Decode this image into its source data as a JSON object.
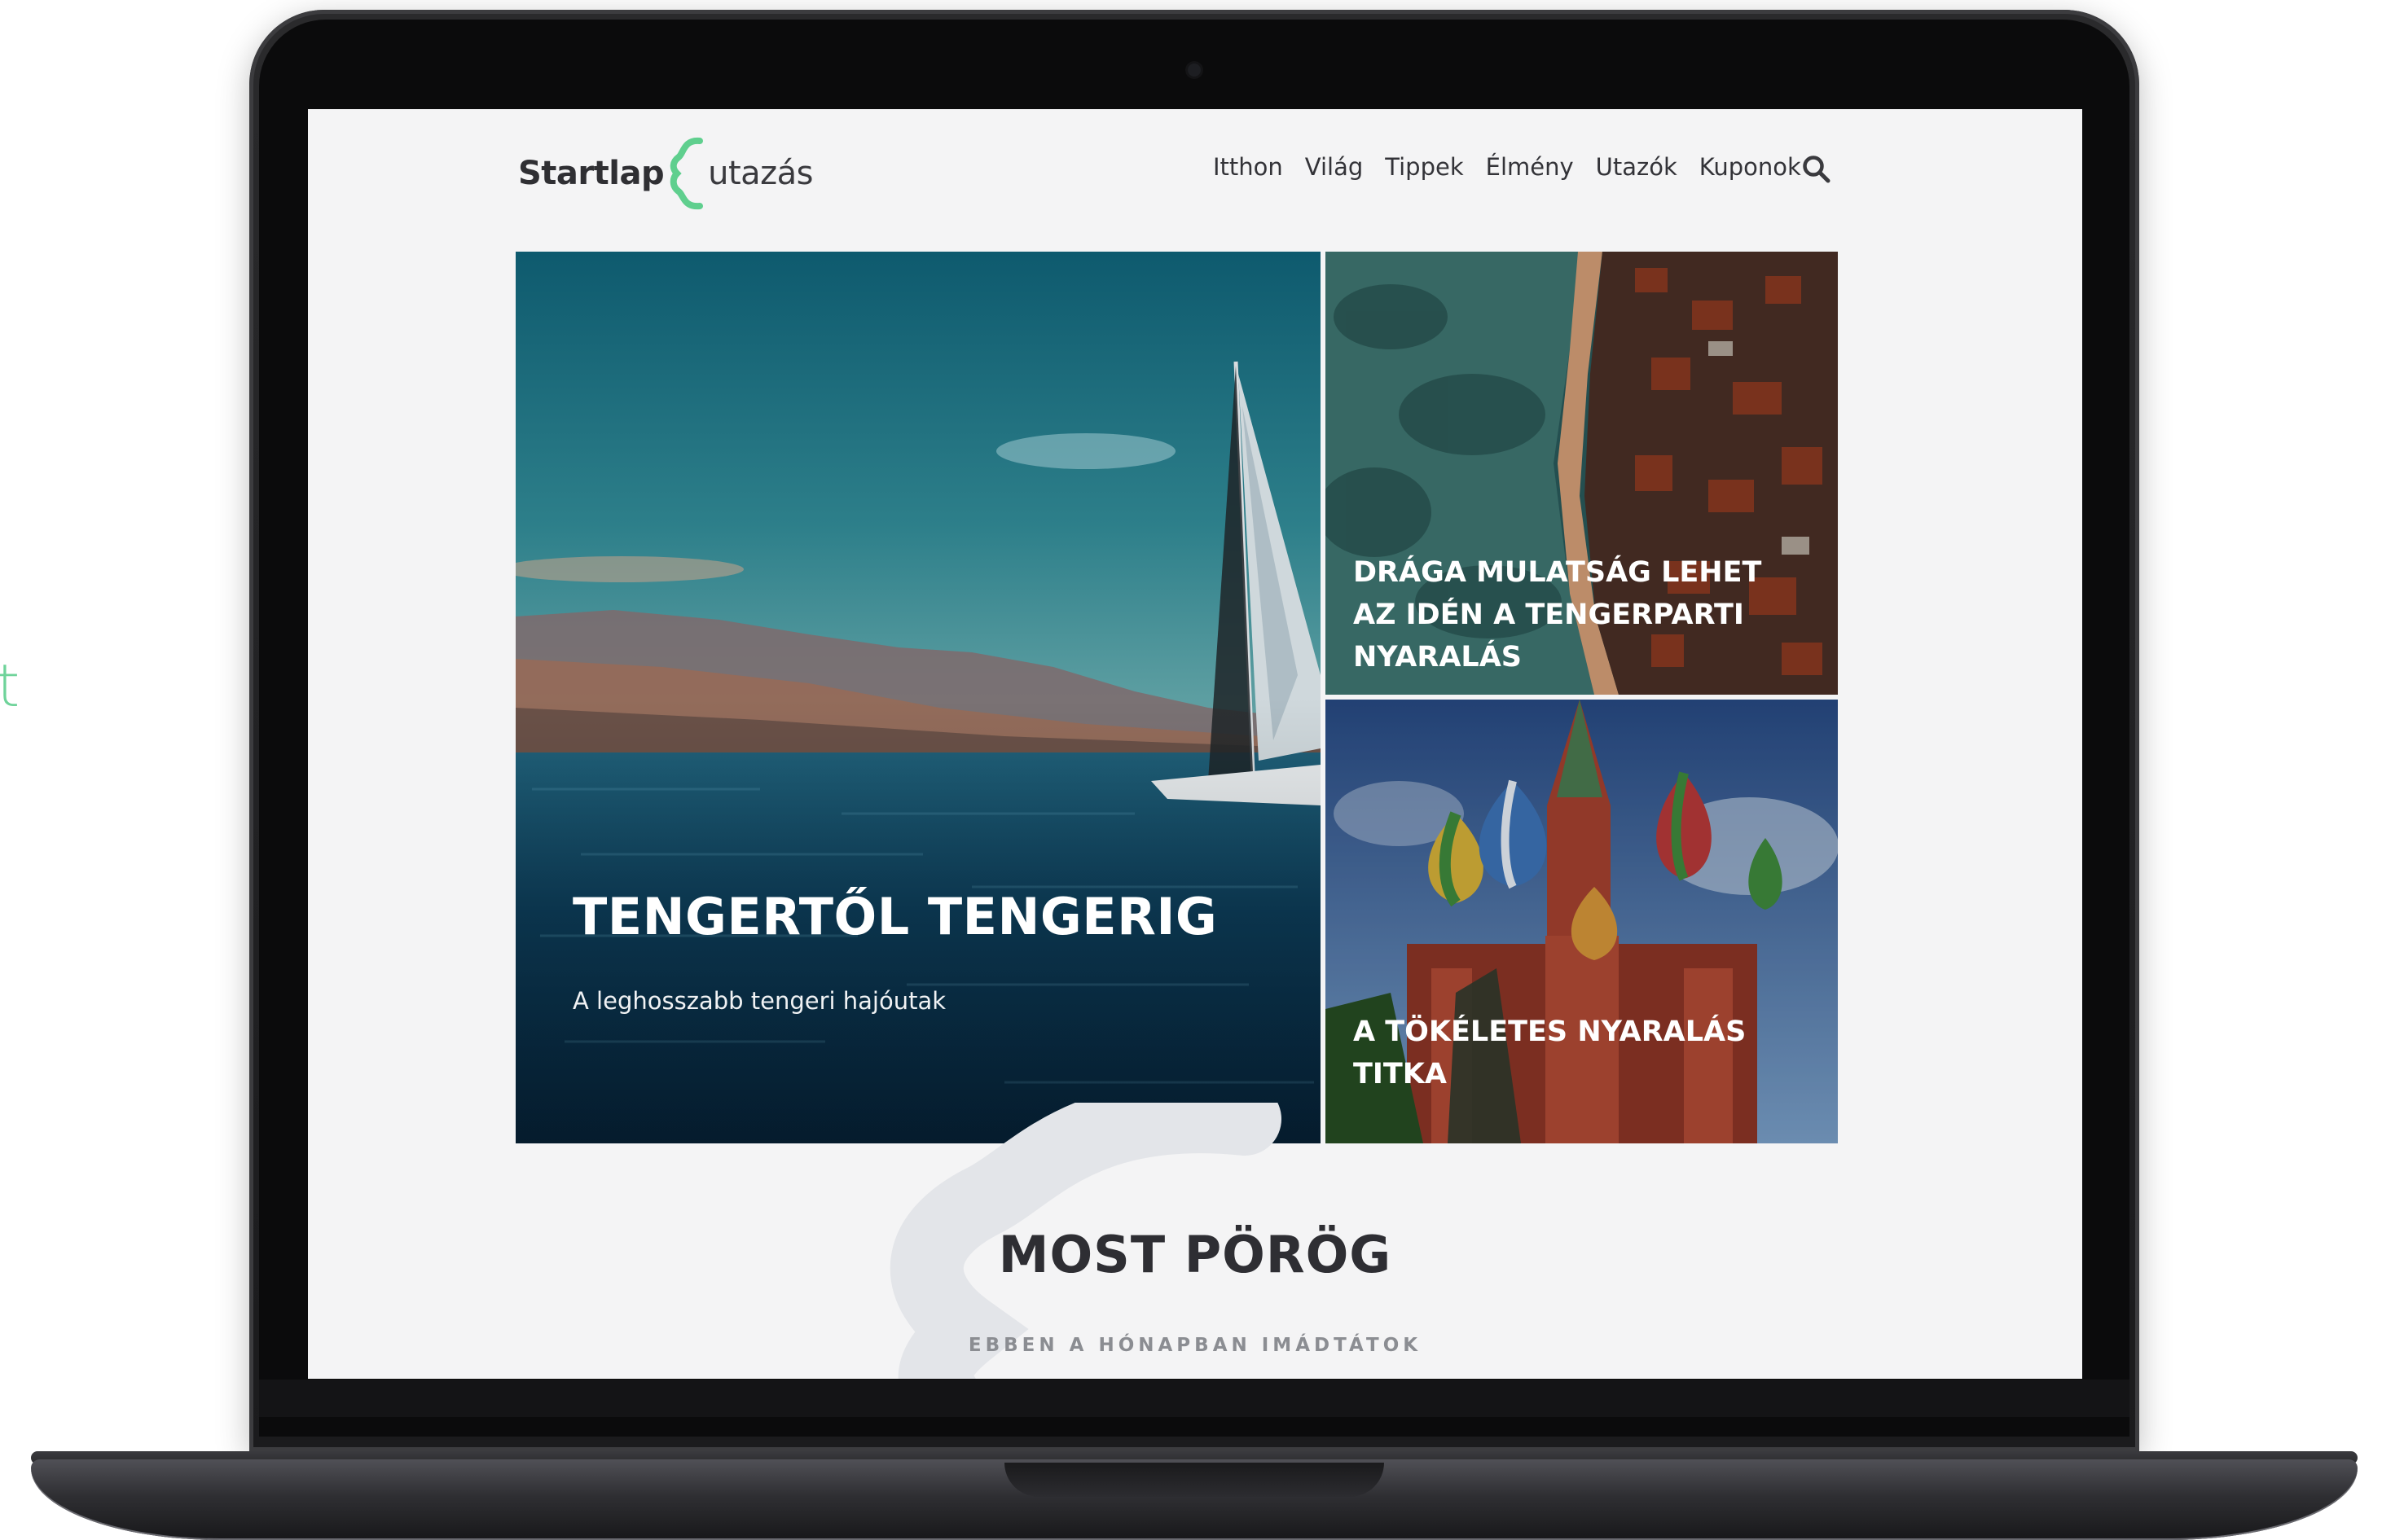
{
  "edge_glyph": "t",
  "header": {
    "logo_start": "Startlap",
    "logo_utazas": "utazás",
    "accent_color": "#5fcf8e",
    "nav": [
      "Itthon",
      "Világ",
      "Tippek",
      "Élmény",
      "Utazók",
      "Kuponok"
    ],
    "search_icon": "search-icon"
  },
  "hero": {
    "title": "TENGERTŐL TENGERIG",
    "subtitle": "A leghosszabb tengeri hajóutak"
  },
  "cards": [
    {
      "title": "DRÁGA MULATSÁG LEHET AZ IDÉN A TENGERPARTI NYARALÁS"
    },
    {
      "title": "A TÖKÉLETES NYARALÁS TITKA"
    }
  ],
  "section": {
    "title": "MOST PÖRÖG",
    "subtitle": "EBBEN A HÓNAPBAN IMÁDTÁTOK"
  }
}
